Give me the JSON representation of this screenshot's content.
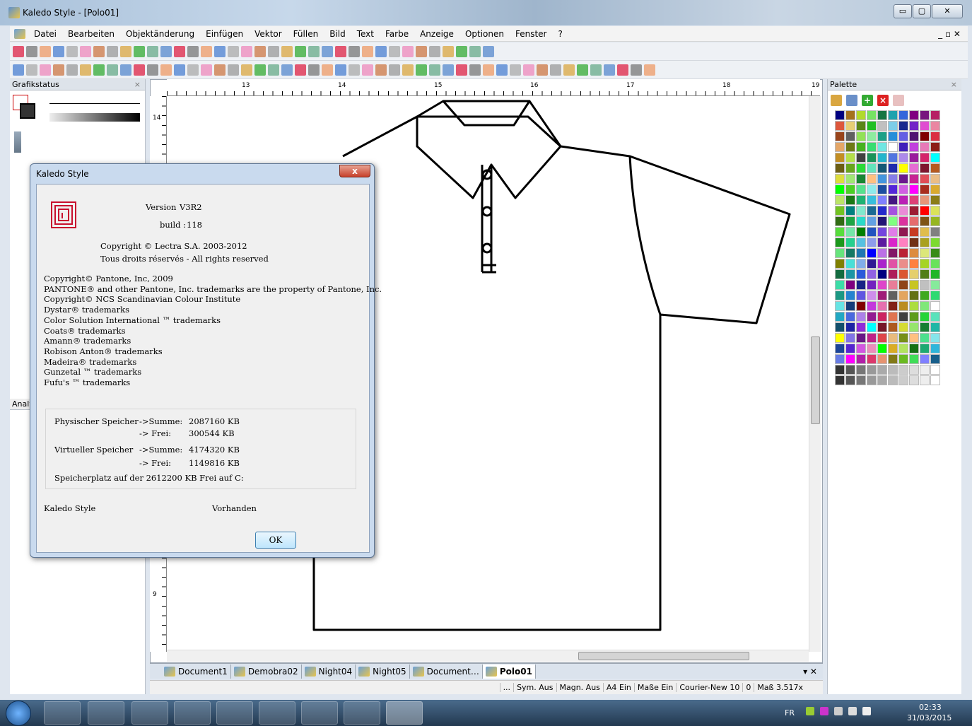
{
  "window": {
    "title": "Kaledo Style - [Polo01]",
    "btn_min": "▭",
    "btn_max": "▢",
    "btn_close": "✕",
    "doc_ctrl": "_ ▫ ✕"
  },
  "menu": [
    "Datei",
    "Bearbeiten",
    "Objektänderung",
    "Einfügen",
    "Vektor",
    "Füllen",
    "Bild",
    "Text",
    "Farbe",
    "Anzeige",
    "Optionen",
    "Fenster",
    "?"
  ],
  "left_panel": {
    "title": "Grafikstatus",
    "close": "×",
    "analysis_label": "Analy"
  },
  "palette_panel": {
    "title": "Palette",
    "close": "×"
  },
  "ruler": {
    "h_ticks": [
      "13",
      "14",
      "15",
      "16",
      "17",
      "18",
      "19"
    ],
    "v_ticks": [
      "14",
      "9"
    ]
  },
  "tabs": [
    "Document1",
    "Demobra02",
    "Night04",
    "Night05",
    "Document…",
    "Polo01"
  ],
  "tabs_ctrl": "▾ ✕",
  "status": [
    "...",
    "Sym. Aus",
    "Magn. Aus",
    "A4 Ein",
    "Maße Ein",
    "Courier-New 10",
    "0",
    "Maß 3.517x"
  ],
  "dialog": {
    "title": "Kaledo Style",
    "close": "x",
    "version_label": "Version",
    "version": "V3R2",
    "build_label": "build :",
    "build": "118",
    "copyright": "Copyright © Lectra S.A. 2003-2012",
    "rights": "Tous droits réservés - All rights reserved",
    "trademarks": [
      "Copyright© Pantone, Inc, 2009",
      "PANTONE® and other Pantone, Inc. trademarks are the property of Pantone, Inc.",
      "Copyright© NCS Scandinavian Colour Institute",
      "Dystar® trademarks",
      "Color Solution International ™ trademarks",
      "Coats® trademarks",
      "Amann® trademarks",
      "Robison Anton® trademarks",
      "Madeira® trademarks",
      "Gunzetal ™ trademarks",
      "Fufu's ™ trademarks"
    ],
    "phys_label": "Physischer Speicher",
    "virt_label": "Virtueller Speicher",
    "sum_label": "->Summe:",
    "free_label": "-> Frei:",
    "phys_sum": "2087160 KB",
    "phys_free": "300544 KB",
    "virt_sum": "4174320 KB",
    "virt_free": "1149816 KB",
    "disk": "Speicherplatz auf der  2612200 KB Frei auf C:",
    "product": "Kaledo Style",
    "status": "Vorhanden",
    "ok": "OK"
  },
  "taskbar": {
    "lang": "FR",
    "time": "02:33",
    "date": "31/03/2015"
  },
  "colors": {
    "accent": "#c8102e"
  }
}
